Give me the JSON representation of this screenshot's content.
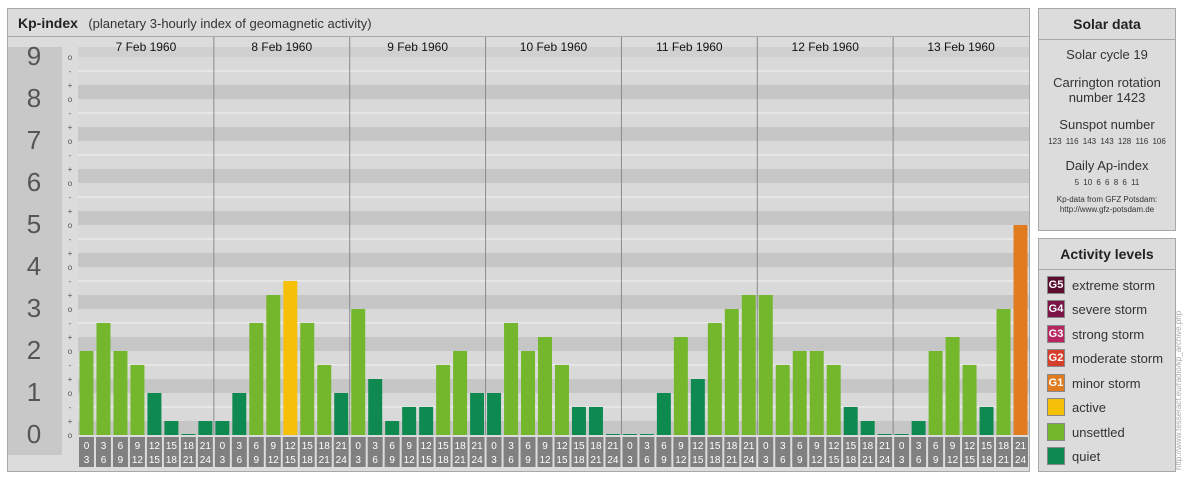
{
  "title": "Kp-index",
  "subtitle": "(planetary 3-hourly index of geomagnetic activity)",
  "chart_data": {
    "type": "bar",
    "y_axis_labels": [
      "0",
      "1",
      "2",
      "3",
      "4",
      "5",
      "6",
      "7",
      "8",
      "9"
    ],
    "y_minor_labels": [
      "o",
      "+",
      "-",
      "o",
      "+",
      "-",
      "o",
      "+",
      "-",
      "o",
      "+",
      "-",
      "o",
      "+",
      "-",
      "o",
      "+",
      "-",
      "o",
      "+",
      "-",
      "o",
      "+",
      "-",
      "o",
      "+",
      "-",
      "o"
    ],
    "ylim": [
      0,
      9
    ],
    "days": [
      "7 Feb 1960",
      "8 Feb 1960",
      "9 Feb 1960",
      "10 Feb 1960",
      "11 Feb 1960",
      "12 Feb 1960",
      "13 Feb 1960"
    ],
    "interval_start": [
      "0",
      "3",
      "6",
      "9",
      "12",
      "15",
      "18",
      "21"
    ],
    "interval_end": [
      "3",
      "6",
      "9",
      "12",
      "15",
      "18",
      "21",
      "24"
    ],
    "values": [
      [
        2.0,
        2.667,
        2.0,
        1.667,
        1.0,
        0.333,
        0.0,
        0.333
      ],
      [
        0.333,
        1.0,
        2.667,
        3.333,
        3.667,
        2.667,
        1.667,
        1.0
      ],
      [
        3.0,
        1.333,
        0.333,
        0.667,
        0.667,
        1.667,
        2.0,
        1.0
      ],
      [
        1.0,
        2.667,
        2.0,
        2.333,
        1.667,
        0.667,
        0.667,
        0.0
      ],
      [
        0.0,
        0.0,
        1.0,
        2.333,
        1.333,
        2.667,
        3.0,
        3.333
      ],
      [
        3.333,
        1.667,
        2.0,
        2.0,
        1.667,
        0.667,
        0.333,
        0.0
      ],
      [
        0.0,
        0.333,
        2.0,
        2.333,
        1.667,
        0.667,
        3.0,
        5.0
      ]
    ],
    "bar_colors": [
      [
        "#74b72c",
        "#74b72c",
        "#74b72c",
        "#74b72c",
        "#0e8a50",
        "#0e8a50",
        "#0e8a50",
        "#0e8a50"
      ],
      [
        "#0e8a50",
        "#0e8a50",
        "#74b72c",
        "#74b72c",
        "#f6c008",
        "#74b72c",
        "#74b72c",
        "#0e8a50"
      ],
      [
        "#74b72c",
        "#0e8a50",
        "#0e8a50",
        "#0e8a50",
        "#0e8a50",
        "#74b72c",
        "#74b72c",
        "#0e8a50"
      ],
      [
        "#0e8a50",
        "#74b72c",
        "#74b72c",
        "#74b72c",
        "#74b72c",
        "#0e8a50",
        "#0e8a50",
        "#0e8a50"
      ],
      [
        "#0e8a50",
        "#0e8a50",
        "#0e8a50",
        "#74b72c",
        "#0e8a50",
        "#74b72c",
        "#74b72c",
        "#74b72c"
      ],
      [
        "#74b72c",
        "#74b72c",
        "#74b72c",
        "#74b72c",
        "#74b72c",
        "#0e8a50",
        "#0e8a50",
        "#0e8a50"
      ],
      [
        "#0e8a50",
        "#0e8a50",
        "#74b72c",
        "#74b72c",
        "#74b72c",
        "#0e8a50",
        "#74b72c",
        "#e07b1f"
      ]
    ],
    "grid": true
  },
  "solar": {
    "header": "Solar data",
    "cycle": "Solar cycle 19",
    "carrington_line1": "Carrington rotation",
    "carrington_line2": "number 1423",
    "sunspot_label": "Sunspot number",
    "sunspot_values": "123 116 143 143 128 116 106",
    "ap_label": "Daily Ap-index",
    "ap_values": "5 10 6 6 8 6 11",
    "credit_line1": "Kp-data from GFZ Potsdam:",
    "credit_line2": "http://www.gfz-potsdam.de"
  },
  "activity": {
    "header": "Activity levels",
    "items": [
      {
        "badge": "G5",
        "label": "extreme storm",
        "color": "#5a0f2e"
      },
      {
        "badge": "G4",
        "label": "severe storm",
        "color": "#7a1445"
      },
      {
        "badge": "G3",
        "label": "strong storm",
        "color": "#b8265f"
      },
      {
        "badge": "G2",
        "label": "moderate storm",
        "color": "#d6402a"
      },
      {
        "badge": "G1",
        "label": "minor storm",
        "color": "#e07b1f"
      },
      {
        "badge": "",
        "label": "active",
        "color": "#f6c008"
      },
      {
        "badge": "",
        "label": "unsettled",
        "color": "#74b72c"
      },
      {
        "badge": "",
        "label": "quiet",
        "color": "#0e8a50"
      }
    ]
  },
  "watermark": "http://www.tesseract.eu/radio/kp_archive.php"
}
